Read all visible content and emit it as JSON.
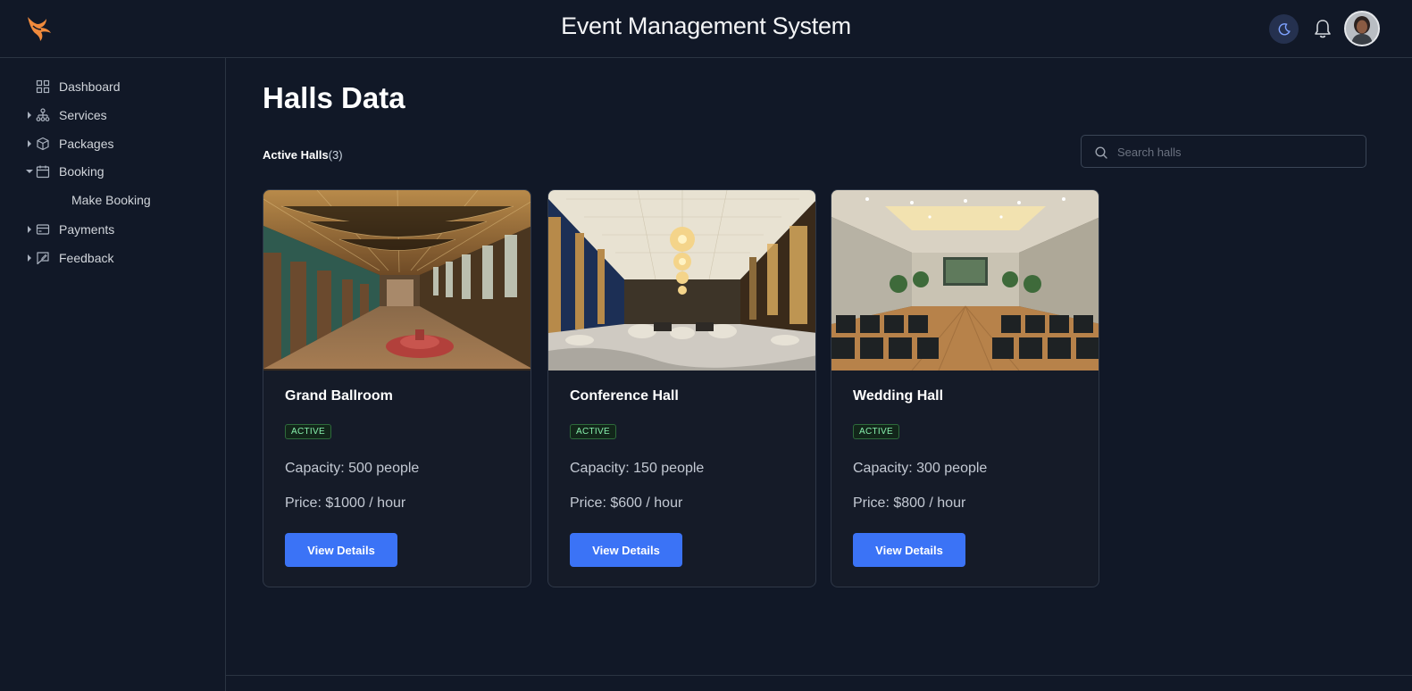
{
  "header": {
    "title": "Event Management System",
    "logo_icon": "phoenix-logo-icon",
    "theme_icon": "moon-icon",
    "notification_icon": "bell-icon"
  },
  "sidebar": {
    "items": [
      {
        "label": "Dashboard",
        "icon": "grid-icon",
        "caret": "none"
      },
      {
        "label": "Services",
        "icon": "sitemap-icon",
        "caret": "right"
      },
      {
        "label": "Packages",
        "icon": "box-icon",
        "caret": "right"
      },
      {
        "label": "Booking",
        "icon": "calendar-icon",
        "caret": "down"
      },
      {
        "label": "Make Booking",
        "icon": "none",
        "caret": "none"
      },
      {
        "label": "Payments",
        "icon": "credit-card-icon",
        "caret": "right"
      },
      {
        "label": "Feedback",
        "icon": "feedback-icon",
        "caret": "right"
      }
    ]
  },
  "main": {
    "title": "Halls Data",
    "active_label": "Active Halls",
    "active_count": "(3)",
    "search": {
      "placeholder": "Search halls",
      "value": ""
    },
    "halls": [
      {
        "name": "Grand Ballroom",
        "status": "ACTIVE",
        "capacity": "Capacity: 500 people",
        "price": "Price: $1000 / hour",
        "button": "View Details"
      },
      {
        "name": "Conference Hall",
        "status": "ACTIVE",
        "capacity": "Capacity: 150 people",
        "price": "Price: $600 / hour",
        "button": "View Details"
      },
      {
        "name": "Wedding Hall",
        "status": "ACTIVE",
        "capacity": "Capacity: 300 people",
        "price": "Price: $800 / hour",
        "button": "View Details"
      }
    ]
  },
  "colors": {
    "background": "#111827",
    "accent": "#3b73f6",
    "active_badge": "#86efac",
    "logo": "#f08a3c"
  }
}
